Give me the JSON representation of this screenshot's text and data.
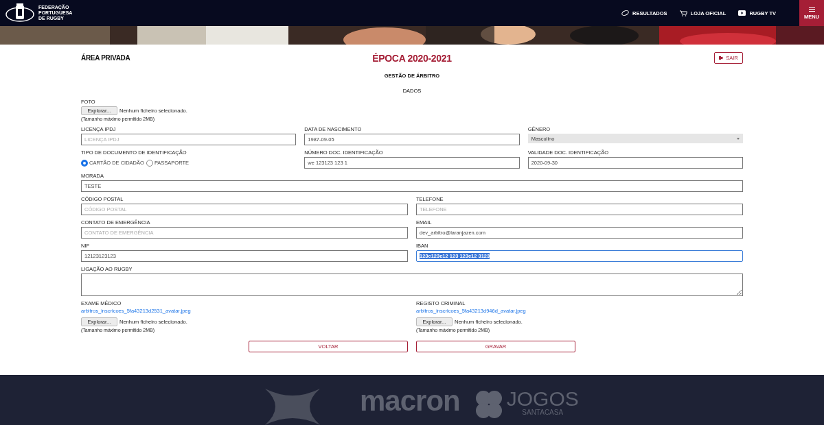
{
  "header": {
    "brand": [
      "FEDERAÇÃO",
      "PORTUGUESA",
      "DE RUGBY"
    ],
    "nav": [
      {
        "kind": "ball",
        "label": "RESULTADOS"
      },
      {
        "kind": "cart",
        "label": "LOJA OFICIAL"
      },
      {
        "kind": "play",
        "label": "RUGBY TV"
      }
    ],
    "menu": {
      "label": "MENU"
    }
  },
  "page": {
    "section": "ÁREA PRIVADA",
    "season": "ÉPOCA 2020-2021",
    "logout": "SAIR",
    "subtitle": "GESTÃO DE ÁRBITRO",
    "heading": "DADOS"
  },
  "photo": {
    "label": "FOTO",
    "button": "Explorar...",
    "status": "Nenhum ficheiro selecionado.",
    "hint": "(Tamanho máximo permitido 2MB)"
  },
  "rows": [
    [
      {
        "kind": "text",
        "label": "LICENÇA IPDJ",
        "placeholder": "LICENÇA IPDJ",
        "focused": false
      },
      {
        "kind": "text",
        "label": "DATA DE NASCIMENTO",
        "value": "1987-09-05",
        "focused": false
      },
      {
        "kind": "select",
        "label": "GÉNERO",
        "value": "Masculino"
      }
    ],
    [
      {
        "kind": "radio",
        "label": "TIPO DE DOCUMENTO DE IDENTIFICAÇÃO",
        "options": [
          {
            "label": "CARTÃO DE CIDADÃO",
            "selected": true
          },
          {
            "label": "PASSAPORTE",
            "selected": false
          }
        ]
      },
      {
        "kind": "text",
        "label": "NÚMERO DOC. IDENTIFICAÇÃO",
        "value": "we 123123 123 1",
        "focused": false
      },
      {
        "kind": "text",
        "label": "VALIDADE DOC. IDENTIFICAÇÃO",
        "value": "2020-09-30",
        "focused": false
      }
    ],
    [
      {
        "kind": "text",
        "label": "MORADA",
        "value": "TESTE",
        "focused": false
      }
    ],
    [
      {
        "kind": "text",
        "label": "CÓDIGO POSTAL",
        "placeholder": "CÓDIGO POSTAL",
        "focused": false
      },
      {
        "kind": "text",
        "label": "TELEFONE",
        "placeholder": "TELEFONE",
        "focused": false
      }
    ],
    [
      {
        "kind": "text",
        "label": "CONTATO DE EMERGÊNCIA",
        "placeholder": "CONTATO DE EMERGÊNCIA",
        "focused": false
      },
      {
        "kind": "text",
        "label": "EMAIL",
        "value": "dev_arbitro@laranjazen.com",
        "focused": false
      }
    ],
    [
      {
        "kind": "text",
        "label": "NIF",
        "value": "12123123123",
        "focused": false
      },
      {
        "kind": "text",
        "label": "IBAN",
        "value": "123c123c12 123 123c12 3123",
        "focused": true
      }
    ],
    [
      {
        "kind": "textarea",
        "label": "LIGAÇÃO AO RUGBY"
      }
    ]
  ],
  "files": [
    {
      "label": "EXAME MÉDICO",
      "link": "arbitros_inscricoes_5fa43213d2531_avatar.jpeg",
      "button": "Explorar...",
      "status": "Nenhum ficheiro selecionado.",
      "hint": "(Tamanho máximo permitido 2MB)"
    },
    {
      "label": "REGISTO CRIMINAL",
      "link": "arbitros_inscricoes_5fa43213d946d_avatar.jpeg",
      "button": "Explorar...",
      "status": "Nenhum ficheiro selecionado.",
      "hint": "(Tamanho máximo permitido 2MB)"
    }
  ],
  "actions": [
    "VOLTAR",
    "GRAVAR"
  ],
  "footer": {
    "sponsors": [
      "macron",
      "JOGOS",
      "SANTACASA"
    ]
  }
}
